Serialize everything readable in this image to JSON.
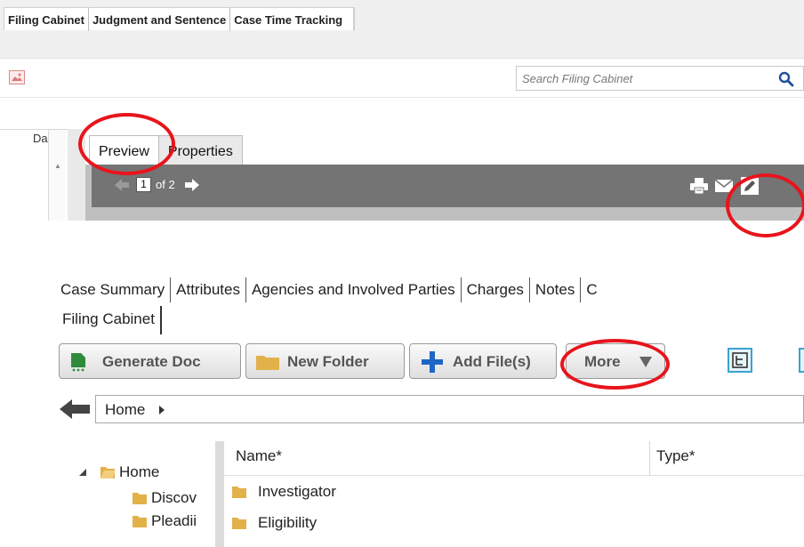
{
  "top_tabs": [
    "Filing Cabinet",
    "Judgment and Sentence",
    "Case Time Tracking"
  ],
  "search": {
    "placeholder": "Search Filing Cabinet"
  },
  "date_column": {
    "header": "Da"
  },
  "preview": {
    "tabs": [
      "Preview",
      "Properties"
    ],
    "active_tab": "Preview",
    "page_number": "1",
    "page_of": "of 2"
  },
  "case_tabs": [
    "Case Summary",
    "Attributes",
    "Agencies and Involved Parties",
    "Charges",
    "Notes",
    "C"
  ],
  "subtabs": [
    "Filing Cabinet"
  ],
  "actions": {
    "generate_doc": "Generate Doc",
    "new_folder": "New Folder",
    "add_files": "Add File(s)",
    "more": "More"
  },
  "breadcrumb": {
    "home": "Home"
  },
  "tree": {
    "root": "Home",
    "children": [
      "Discov",
      "Pleadii"
    ]
  },
  "file_list": {
    "columns": {
      "name": "Name*",
      "type": "Type*"
    },
    "rows": [
      "Investigator",
      "Eligibility"
    ]
  },
  "colors": {
    "highlight": "#e8141c",
    "folder": "#e2b14a",
    "accent_blue": "#1f66c4",
    "toolbar_gray": "#747474"
  },
  "icons": [
    "broken-image-icon",
    "search-icon",
    "prev-page-icon",
    "next-page-icon",
    "print-icon",
    "mail-icon",
    "edit-icon",
    "generate-doc-icon",
    "folder-icon",
    "plus-icon",
    "dropdown-arrow-icon",
    "tree-view-icon",
    "back-arrow-icon",
    "chevron-right-icon",
    "expand-triangle-icon"
  ]
}
